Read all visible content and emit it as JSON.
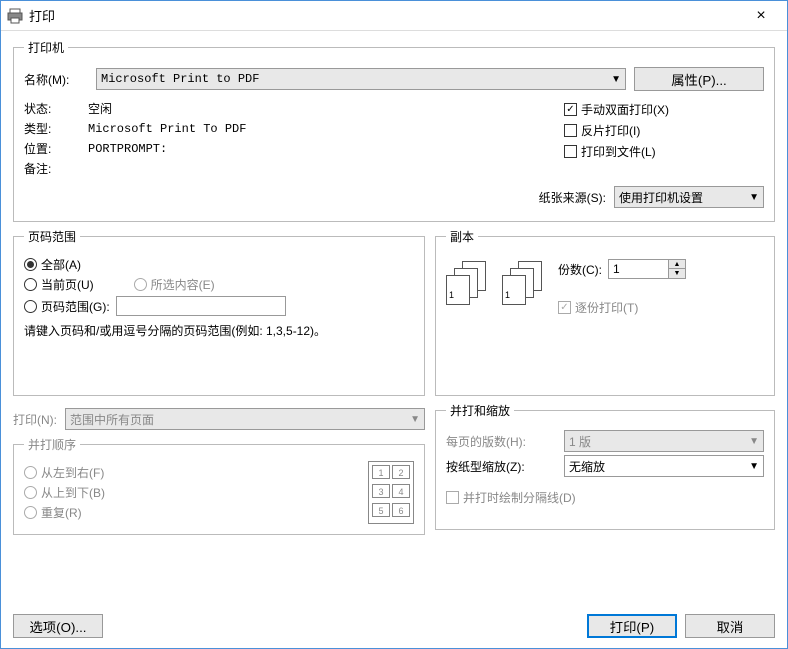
{
  "titlebar": {
    "title": "打印"
  },
  "printer": {
    "legend": "打印机",
    "name_label": "名称(M):",
    "name_value": "Microsoft Print to PDF",
    "properties_btn": "属性(P)...",
    "status_label": "状态:",
    "status_value": "空闲",
    "type_label": "类型:",
    "type_value": "Microsoft Print To PDF",
    "where_label": "位置:",
    "where_value": "PORTPROMPT:",
    "comment_label": "备注:",
    "comment_value": "",
    "manual_duplex": "手动双面打印(X)",
    "reverse": "反片打印(I)",
    "print_to_file": "打印到文件(L)",
    "paper_source_label": "纸张来源(S):",
    "paper_source_value": "使用打印机设置"
  },
  "range": {
    "legend": "页码范围",
    "all": "全部(A)",
    "current": "当前页(U)",
    "selection": "所选内容(E)",
    "pages": "页码范围(G):",
    "pages_value": "",
    "hint": "请键入页码和/或用逗号分隔的页码范围(例如: 1,3,5-12)。"
  },
  "copies": {
    "legend": "副本",
    "count_label": "份数(C):",
    "count_value": "1",
    "collate": "逐份打印(T)"
  },
  "printwhat": {
    "label": "打印(N):",
    "value": "范围中所有页面"
  },
  "order": {
    "legend": "并打顺序",
    "ltr": "从左到右(F)",
    "ttb": "从上到下(B)",
    "repeat": "重复(R)"
  },
  "zoom": {
    "legend": "并打和缩放",
    "pages_per_sheet_label": "每页的版数(H):",
    "pages_per_sheet_value": "1 版",
    "scale_label": "按纸型缩放(Z):",
    "scale_value": "无缩放",
    "draw_borders": "并打时绘制分隔线(D)"
  },
  "footer": {
    "options": "选项(O)...",
    "print": "打印(P)",
    "cancel": "取消"
  }
}
